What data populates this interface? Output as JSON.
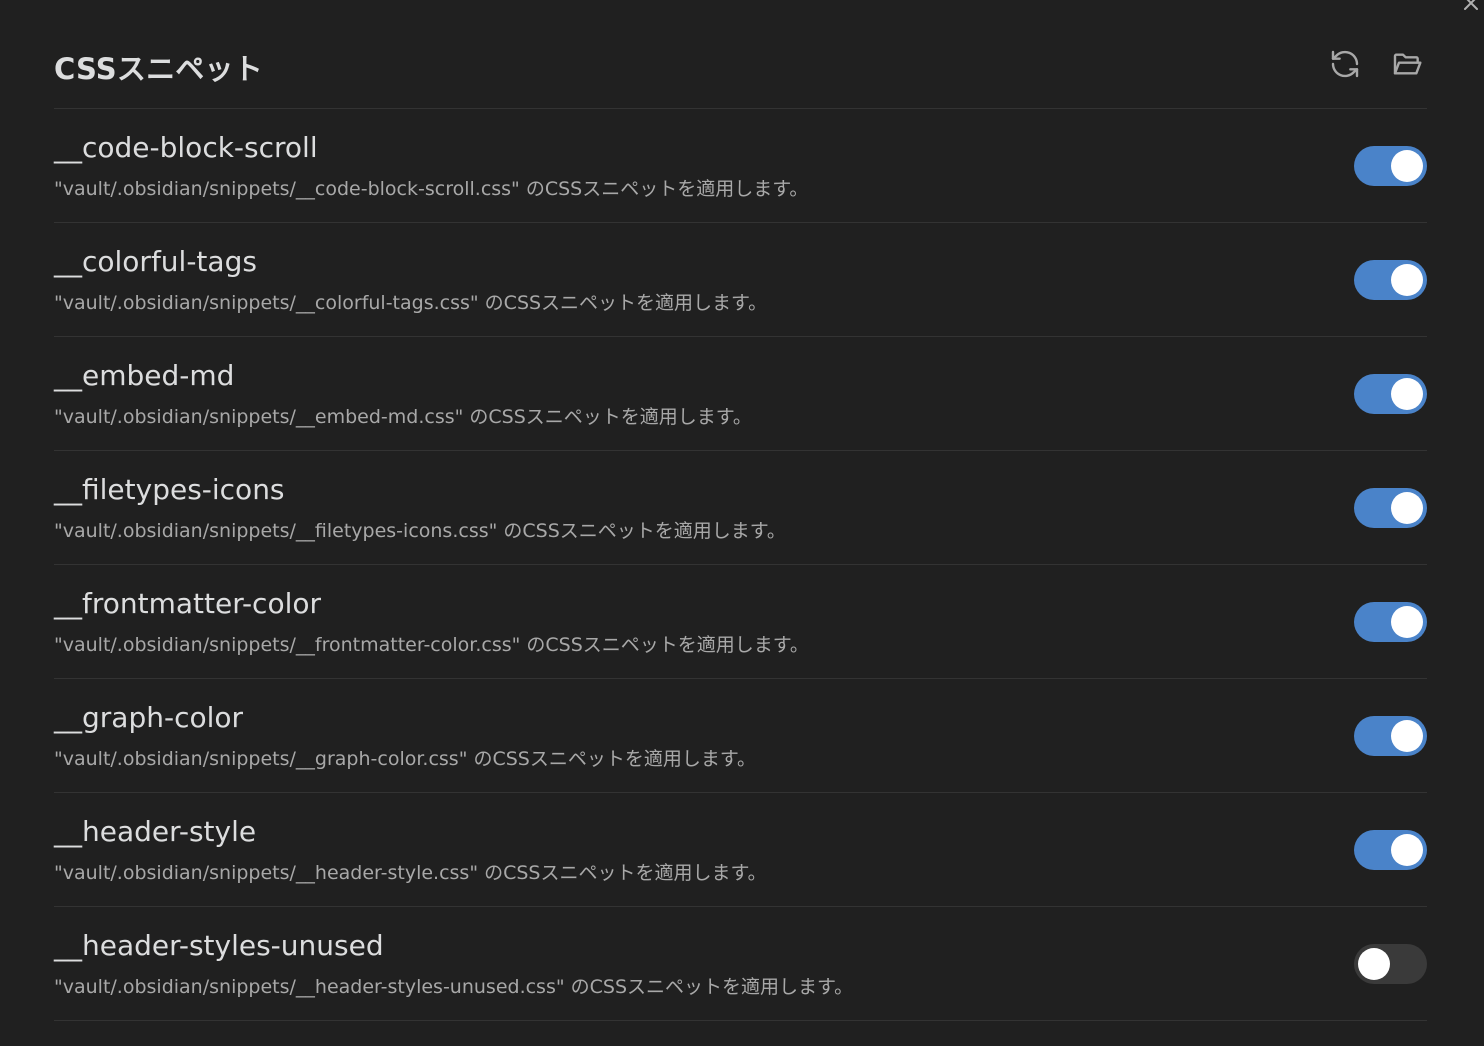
{
  "header": {
    "title": "CSSスニペット",
    "reload_icon": "reload-icon",
    "folder_icon": "folder-open-icon"
  },
  "close_icon": "close-icon",
  "colors": {
    "toggle_on": "#4a83c9",
    "toggle_off": "#3a3a3a",
    "background": "#202020"
  },
  "snippets": [
    {
      "name": "__code-block-scroll",
      "description": "\"vault/.obsidian/snippets/__code-block-scroll.css\" のCSSスニペットを適用します。",
      "enabled": true
    },
    {
      "name": "__colorful-tags",
      "description": "\"vault/.obsidian/snippets/__colorful-tags.css\" のCSSスニペットを適用します。",
      "enabled": true
    },
    {
      "name": "__embed-md",
      "description": "\"vault/.obsidian/snippets/__embed-md.css\" のCSSスニペットを適用します。",
      "enabled": true
    },
    {
      "name": "__filetypes-icons",
      "description": "\"vault/.obsidian/snippets/__filetypes-icons.css\" のCSSスニペットを適用します。",
      "enabled": true
    },
    {
      "name": "__frontmatter-color",
      "description": "\"vault/.obsidian/snippets/__frontmatter-color.css\" のCSSスニペットを適用します。",
      "enabled": true
    },
    {
      "name": "__graph-color",
      "description": "\"vault/.obsidian/snippets/__graph-color.css\" のCSSスニペットを適用します。",
      "enabled": true
    },
    {
      "name": "__header-style",
      "description": "\"vault/.obsidian/snippets/__header-style.css\" のCSSスニペットを適用します。",
      "enabled": true
    },
    {
      "name": "__header-styles-unused",
      "description": "\"vault/.obsidian/snippets/__header-styles-unused.css\" のCSSスニペットを適用します。",
      "enabled": false
    }
  ]
}
